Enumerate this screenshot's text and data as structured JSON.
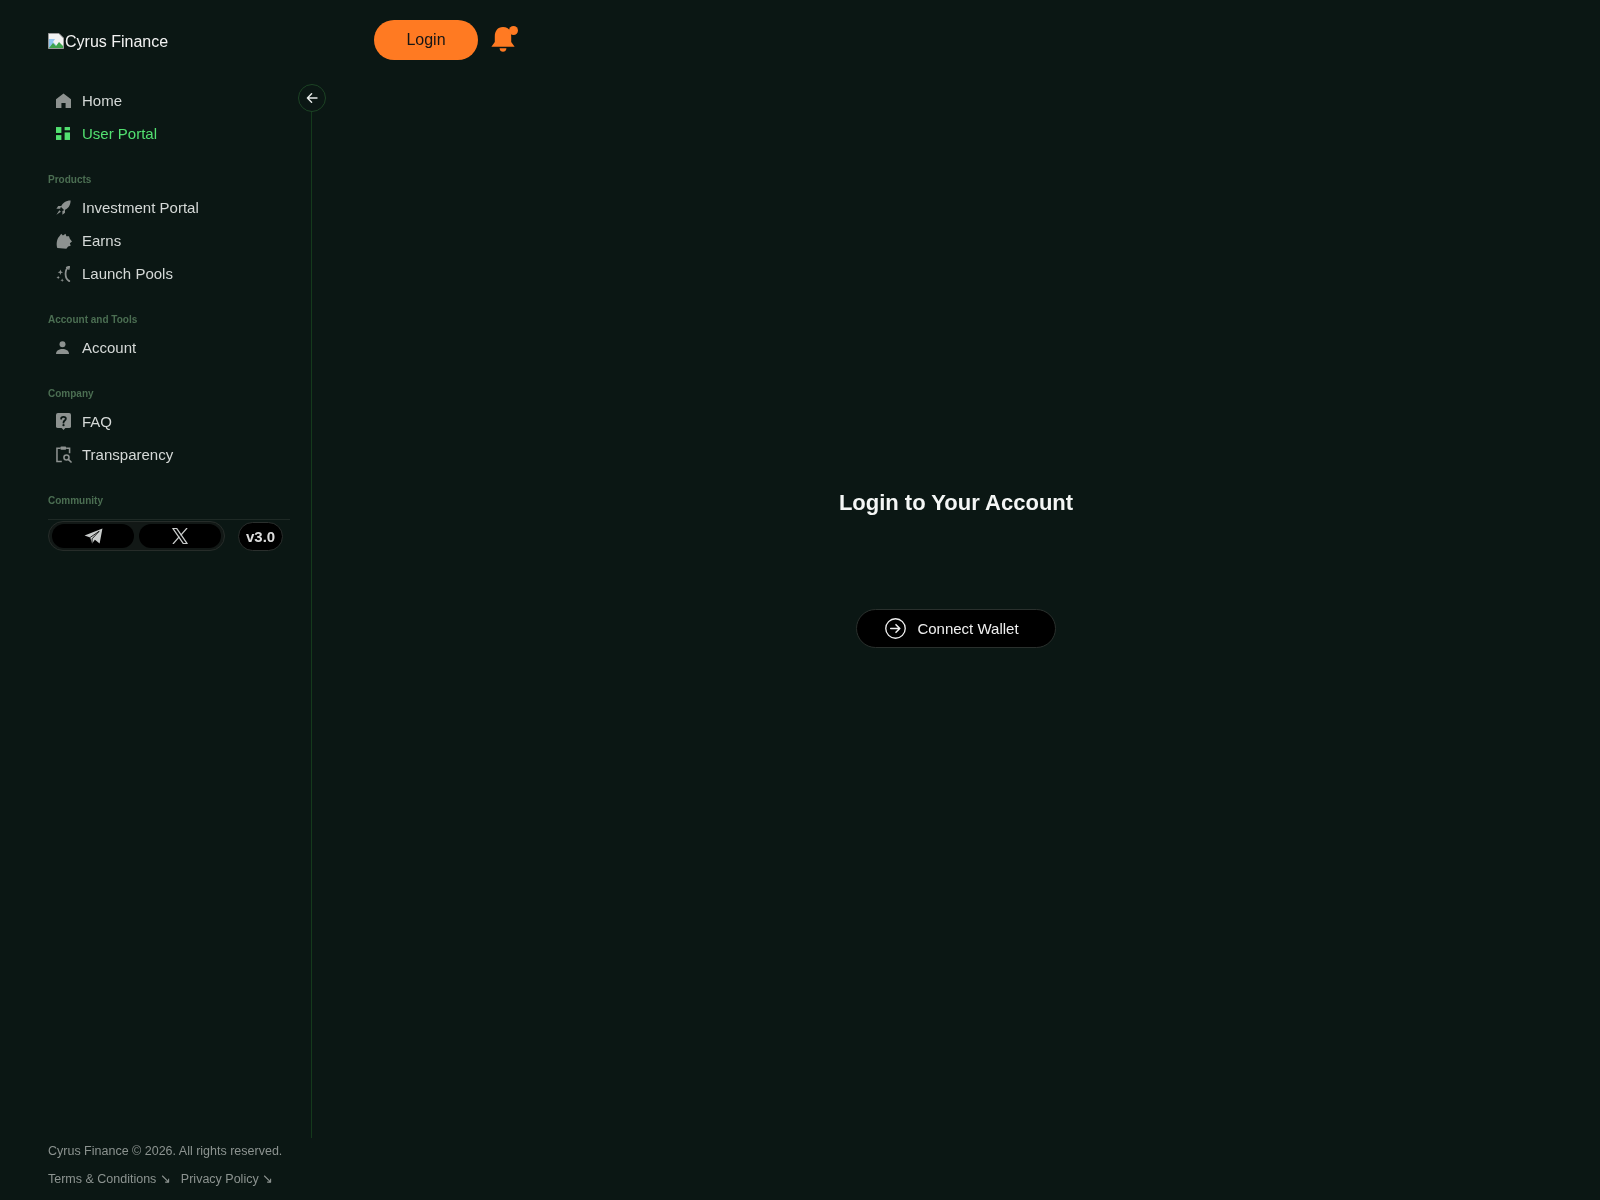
{
  "logo": {
    "alt_text": "Cyrus Finance"
  },
  "header": {
    "login_button": "Login",
    "notifications": {
      "unread": true
    }
  },
  "sidebar": {
    "groups": [
      {
        "items": [
          {
            "label": "Home",
            "selected": false
          },
          {
            "label": "User Portal",
            "selected": true
          }
        ]
      },
      {
        "heading": "Products",
        "items": [
          {
            "label": "Investment Portal",
            "selected": false
          },
          {
            "label": "Earns",
            "selected": false
          },
          {
            "label": "Launch Pools",
            "selected": false
          }
        ]
      },
      {
        "heading": "Account and Tools",
        "items": [
          {
            "label": "Account",
            "selected": false
          }
        ]
      },
      {
        "heading": "Company",
        "items": [
          {
            "label": "FAQ",
            "selected": false
          },
          {
            "label": "Transparency",
            "selected": false
          }
        ]
      }
    ],
    "community": {
      "heading": "Community",
      "version": "v3.0"
    }
  },
  "main": {
    "title": "Login to Your Account",
    "connect_button": "Connect Wallet"
  },
  "footer": {
    "copyright": "Cyrus Finance © 2026. All rights reserved.",
    "links": [
      "Terms & Conditions ↘",
      "Privacy Policy ↘"
    ]
  }
}
